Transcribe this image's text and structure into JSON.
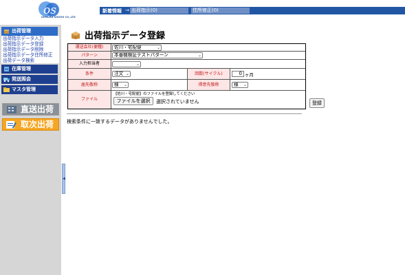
{
  "logo": {
    "text": "OHMURA SHIGYO CO.,LTD"
  },
  "news": {
    "label": "新着情報",
    "items": [
      "出荷指示(0)",
      "住所修正(0)"
    ]
  },
  "sidebar": {
    "shipping_header": "出荷管理",
    "shipping_links": [
      "出荷指示データ入力",
      "出荷指示データ登録",
      "出荷指示データ削除",
      "出荷指示データ住所修正",
      "出荷データ検索"
    ],
    "inventory_header": "在庫管理",
    "dispatch_header": "発送照会",
    "master_header": "マスタ管理",
    "direct_button": "直送出荷",
    "agency_button": "取次出荷"
  },
  "main": {
    "title": "出荷指示データ登録",
    "form": {
      "carrier_label": "運送会社(便種)",
      "carrier_value": "佐川・宅配便",
      "pattern_label": "パターン",
      "pattern_value": "本番機検証テストパターン",
      "input_person_label": "入力担当者",
      "input_person_value": "",
      "condition_label": "条件",
      "condition_value": "注文",
      "cycle_label": "回数(サイクル)",
      "cycle_value": "0",
      "cycle_unit": "ヶ月",
      "shipto_honorific_label": "届先敬称",
      "shipto_honorific_value": "様",
      "client_honorific_label": "得意先敬称",
      "client_honorific_value": "様",
      "file_label": "ファイル",
      "file_note": "【佐川・宅配便】のファイルを登録してください",
      "file_button": "ファイルを選択",
      "file_status": "選択されていません"
    },
    "register_button": "登録",
    "result_message": "検索条件に一致するデータがありませんでした。"
  },
  "colors": {
    "accent": "#2156a5",
    "sidebar_header": "#1e3f8f",
    "label_bg": "#fde6e6",
    "label_text": "#c01818"
  }
}
